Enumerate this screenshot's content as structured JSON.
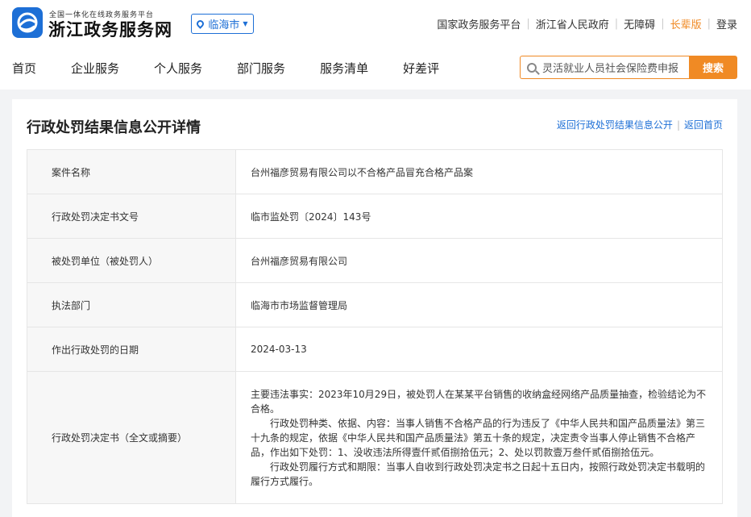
{
  "header": {
    "brand_sub": "全国一体化在线政务服务平台",
    "brand_title": "浙江政务服务网",
    "city": "临海市",
    "top_links": [
      {
        "label": "国家政务服务平台"
      },
      {
        "label": "浙江省人民政府"
      },
      {
        "label": "无障碍"
      },
      {
        "label": "长辈版"
      },
      {
        "label": "登录"
      }
    ],
    "nav": [
      "首页",
      "企业服务",
      "个人服务",
      "部门服务",
      "服务清单",
      "好差评"
    ],
    "search": {
      "value": "灵活就业人员社会保险费申报",
      "button": "搜索"
    }
  },
  "page": {
    "title": "行政处罚结果信息公开详情",
    "back_list": "返回行政处罚结果信息公开",
    "back_home": "返回首页"
  },
  "rows": [
    {
      "key": "案件名称",
      "value": "台州福彦贸易有限公司以不合格产品冒充合格产品案"
    },
    {
      "key": "行政处罚决定书文号",
      "value": "临市监处罚〔2024〕143号"
    },
    {
      "key": "被处罚单位（被处罚人）",
      "value": "台州福彦贸易有限公司"
    },
    {
      "key": "执法部门",
      "value": "临海市市场监督管理局"
    },
    {
      "key": "作出行政处罚的日期",
      "value": "2024-03-13"
    }
  ],
  "decision": {
    "key": "行政处罚决定书（全文或摘要）",
    "paragraphs": [
      "主要违法事实：2023年10月29日，被处罚人在某某平台销售的收纳盒经网络产品质量抽查，检验结论为不合格。",
      "　　行政处罚种类、依据、内容：当事人销售不合格产品的行为违反了《中华人民共和国产品质量法》第三十九条的规定，依据《中华人民共和国产品质量法》第五十条的规定，决定责令当事人停止销售不合格产品，作出如下处罚：1、没收违法所得壹仟贰佰捌拾伍元；2、处以罚款壹万叁仟贰佰捌拾伍元。",
      "　　行政处罚履行方式和期限：当事人自收到行政处罚决定书之日起十五日内，按照行政处罚决定书载明的履行方式履行。"
    ]
  },
  "colors": {
    "brand_blue": "#1d6fd6",
    "accent_orange": "#f08a24"
  },
  "icons": {
    "logo": "zhejiang-logo-icon",
    "city": "location-pin-icon",
    "search": "search-icon"
  }
}
